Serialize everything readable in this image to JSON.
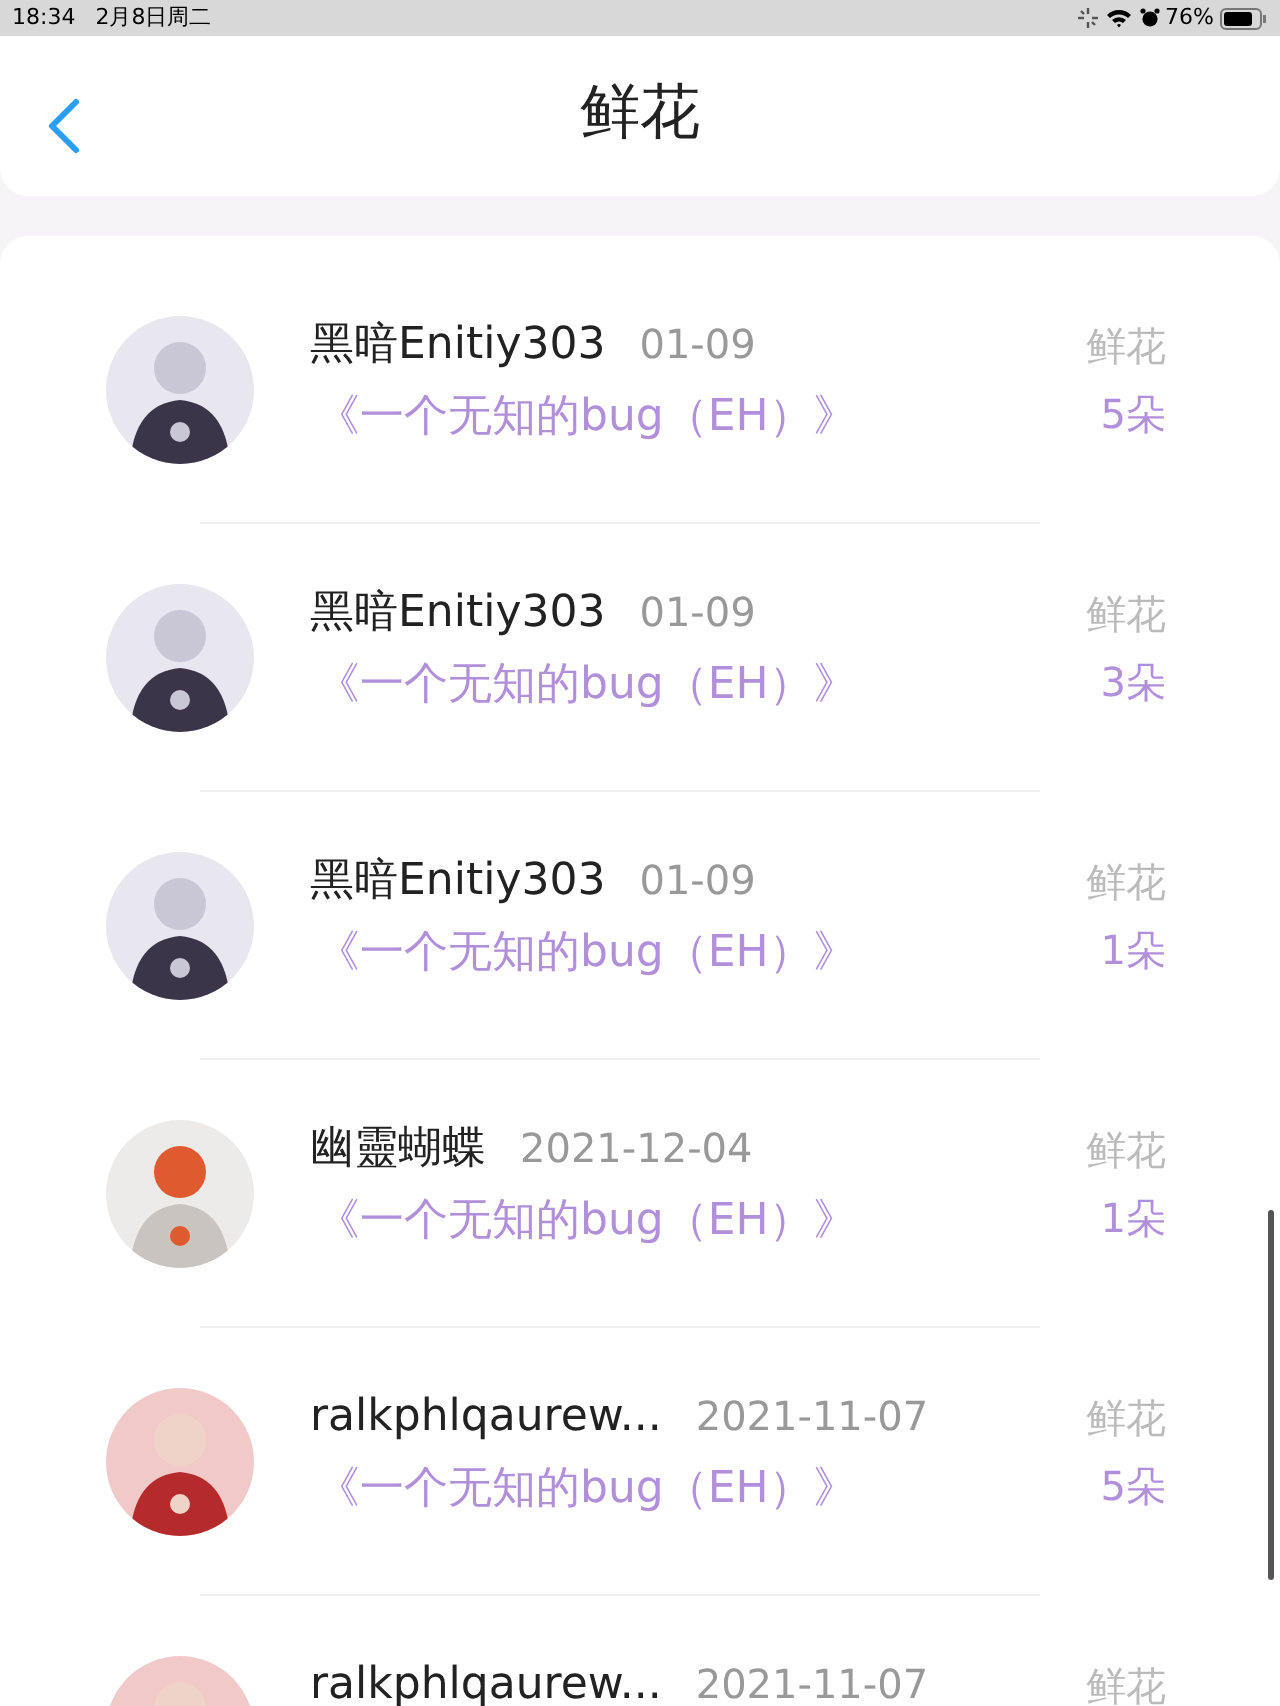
{
  "status_bar": {
    "time": "18:34",
    "date": "2月8日周二",
    "battery": "76%"
  },
  "header": {
    "title": "鲜花"
  },
  "rows": [
    {
      "name": "黑暗Enitiy303",
      "date": "01-09",
      "book": "《一个无知的bug（EH）》",
      "label": "鲜花",
      "count": "5朵"
    },
    {
      "name": "黑暗Enitiy303",
      "date": "01-09",
      "book": "《一个无知的bug（EH）》",
      "label": "鲜花",
      "count": "3朵"
    },
    {
      "name": "黑暗Enitiy303",
      "date": "01-09",
      "book": "《一个无知的bug（EH）》",
      "label": "鲜花",
      "count": "1朵"
    },
    {
      "name": "幽靈蝴蝶",
      "date": "2021-12-04",
      "book": "《一个无知的bug（EH）》",
      "label": "鲜花",
      "count": "1朵"
    },
    {
      "name": "ralkphlqaurew...",
      "date": "2021-11-07",
      "book": "《一个无知的bug（EH）》",
      "label": "鲜花",
      "count": "5朵"
    },
    {
      "name": "ralkphlqaurew...",
      "date": "2021-11-07",
      "label": "鲜花"
    }
  ]
}
